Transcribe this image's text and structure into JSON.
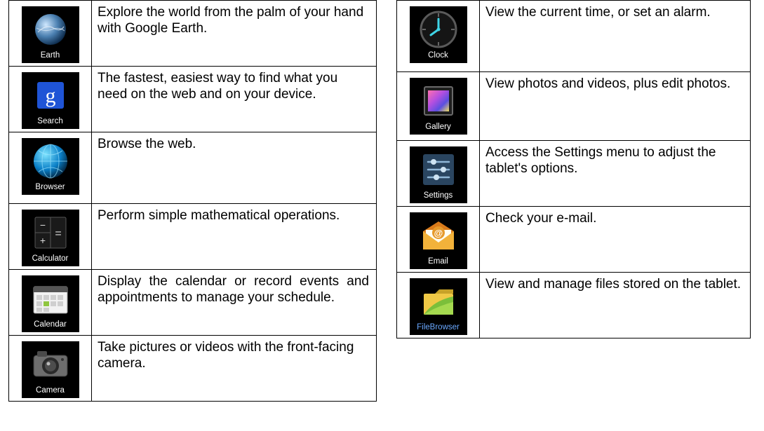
{
  "left": [
    {
      "label": "Earth",
      "desc": "Explore the world from the palm of your hand with Google Earth."
    },
    {
      "label": "Search",
      "desc": "The fastest, easiest way to find what you need on the web and on your device."
    },
    {
      "label": "Browser",
      "desc": "Browse the web."
    },
    {
      "label": "Calculator",
      "desc": "Perform simple mathematical operations."
    },
    {
      "label": "Calendar",
      "desc": "Display the calendar or record events and appointments to manage your schedule."
    },
    {
      "label": "Camera",
      "desc": "Take pictures or videos with the front-facing camera."
    }
  ],
  "right": [
    {
      "label": "Clock",
      "desc": "View the current time, or set an alarm."
    },
    {
      "label": "Gallery",
      "desc": "View photos and videos, plus edit photos."
    },
    {
      "label": "Settings",
      "desc": "Access the Settings menu to adjust the tablet's options."
    },
    {
      "label": "Email",
      "desc": "Check your e-mail."
    },
    {
      "label": "FileBrowser",
      "desc": "View and manage files stored on the tablet."
    }
  ]
}
